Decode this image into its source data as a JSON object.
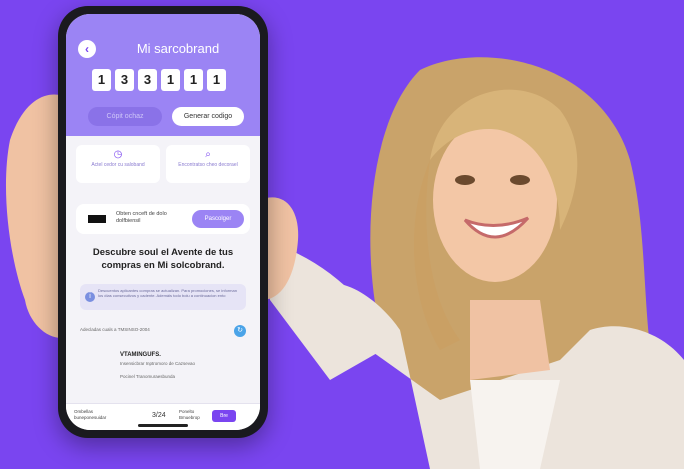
{
  "app": {
    "title": "Mi sarcobrand",
    "back_icon": "arrow-left-icon",
    "code_digits": [
      "1",
      "3",
      "3",
      "1",
      "1",
      "1"
    ],
    "copy_button_label": "Cópit ochaz",
    "generate_button_label": "Generar codigo"
  },
  "quick_actions": [
    {
      "icon": "clock-icon",
      "label": "Actel cedor cu saloband"
    },
    {
      "icon": "search-icon",
      "label": "Encontratso cheo decorael"
    }
  ],
  "promo": {
    "text": "Obten cnceft de dolo dolfbiensil",
    "button_label": "Pascolger"
  },
  "heading": "Descubre soul el Avente de tus compras en Mi solcobrand.",
  "info_banner": "Descuentos aplicantes compras se actualizan. Para promociones, se informan los días consecutivos y cadente. Ademáis todo bolu a continuacion ento",
  "switch_row": {
    "label": "Adecladas cuals a TMSINSO-2004"
  },
  "item": {
    "name": "VTAMINGUFS.",
    "description": "Insensicbrar Inptromoro de Cazsevao",
    "status": "Pocinel Tranomuraesbunda"
  },
  "footer": {
    "left_label": "Ombellas buneponesuidar",
    "count": "3/24",
    "middle_label": "Ponelto Bmuebrop",
    "action_label": "Bre"
  },
  "colors": {
    "background": "#7a45f0",
    "header": "#9b84f4",
    "accent": "#7a45f0"
  }
}
